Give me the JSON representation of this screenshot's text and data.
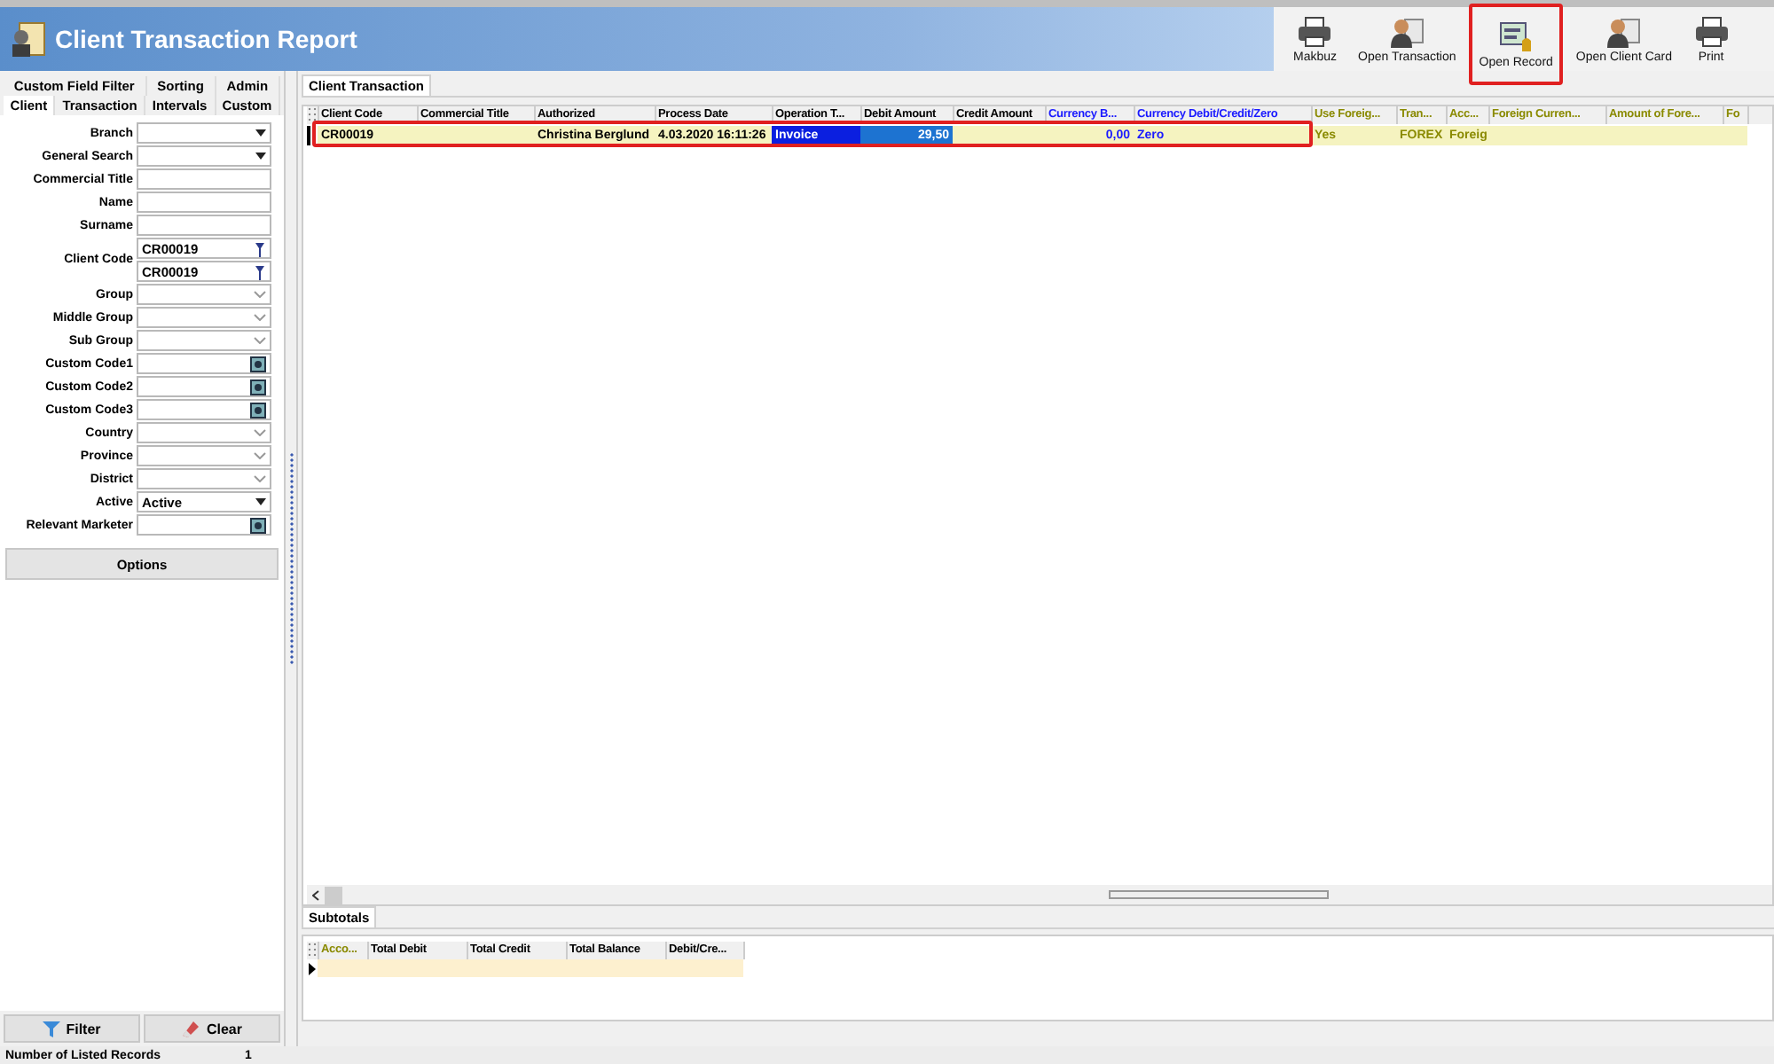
{
  "window": {
    "title": "Client Transaction Report"
  },
  "toolbar": [
    {
      "label": "Makbuz",
      "kind": "printer",
      "outlined": false
    },
    {
      "label": "Open Transaction",
      "kind": "person",
      "outlined": false
    },
    {
      "label": "Open Record",
      "kind": "record",
      "outlined": true
    },
    {
      "label": "Open Client Card",
      "kind": "person",
      "outlined": false
    },
    {
      "label": "Print",
      "kind": "printer",
      "outlined": false
    }
  ],
  "filter_tabs": [
    [
      {
        "label": "Custom Field Filter",
        "selected": false
      },
      {
        "label": "Sorting",
        "selected": false
      },
      {
        "label": "Admin",
        "selected": false
      }
    ],
    [
      {
        "label": "Client",
        "selected": true
      },
      {
        "label": "Transaction",
        "selected": false
      },
      {
        "label": "Intervals",
        "selected": false
      },
      {
        "label": "Custom",
        "selected": false
      }
    ]
  ],
  "fields": [
    {
      "label": "Branch",
      "kind": "dropdown"
    },
    {
      "label": "General Search",
      "kind": "dropdown"
    },
    {
      "label": "Commercial Title",
      "kind": "text"
    },
    {
      "label": "Name",
      "kind": "text"
    },
    {
      "label": "Surname",
      "kind": "text"
    },
    {
      "label": "Client Code",
      "kind": "code",
      "values": [
        "CR00019",
        "CR00019"
      ]
    },
    {
      "label": "Group",
      "kind": "combo"
    },
    {
      "label": "Middle Group",
      "kind": "combo"
    },
    {
      "label": "Sub Group",
      "kind": "combo"
    },
    {
      "label": "Custom Code1",
      "kind": "lookup"
    },
    {
      "label": "Custom Code2",
      "kind": "lookup"
    },
    {
      "label": "Custom Code3",
      "kind": "lookup"
    },
    {
      "label": "Country",
      "kind": "combo"
    },
    {
      "label": "Province",
      "kind": "combo"
    },
    {
      "label": "District",
      "kind": "combo"
    },
    {
      "label": "Active",
      "kind": "dropdown",
      "values": [
        "Active"
      ]
    },
    {
      "label": "Relevant Marketer",
      "kind": "lookup"
    }
  ],
  "options_button": "Options",
  "filter_button": "Filter",
  "clear_button": "Clear",
  "main_tab": "Client Transaction",
  "table": {
    "columns": [
      {
        "label": "Client Code",
        "color": "#000000"
      },
      {
        "label": "Commercial Title",
        "color": "#000000"
      },
      {
        "label": "Authorized",
        "color": "#000000"
      },
      {
        "label": "Process Date",
        "color": "#000000"
      },
      {
        "label": "Operation T...",
        "color": "#000000"
      },
      {
        "label": "Debit Amount",
        "color": "#000000"
      },
      {
        "label": "Credit Amount",
        "color": "#000000"
      },
      {
        "label": "Currency B...",
        "color": "#1a1aff"
      },
      {
        "label": "Currency Debit/Credit/Zero",
        "color": "#1a1aff"
      },
      {
        "label": "Use Foreig...",
        "color": "#8a8a00"
      },
      {
        "label": "Tran...",
        "color": "#8a8a00"
      },
      {
        "label": "Acc...",
        "color": "#8a8a00"
      },
      {
        "label": "Foreign Curren...",
        "color": "#8a8a00"
      },
      {
        "label": "Amount of Fore...",
        "color": "#8a8a00"
      },
      {
        "label": "Fo",
        "color": "#8a8a00"
      }
    ],
    "rows": [
      {
        "outlined": true,
        "cells": [
          {
            "text": "CR00019",
            "selected": false
          },
          {
            "selected": false
          },
          {
            "text": "Christina Berglund",
            "selected": false
          },
          {
            "text": "4.03.2020 16:11:26",
            "selected": false
          },
          {
            "text": "Invoice",
            "selected": true
          },
          {
            "text": "29,50",
            "selected": true
          },
          {
            "selected": false
          },
          {
            "text": "0,00",
            "selected": false
          },
          {
            "text": "Zero",
            "selected": false
          },
          {
            "text": "Yes",
            "selected": false
          },
          {
            "text": "FOREX",
            "selected": false
          },
          {
            "text": "Foreig",
            "selected": false
          },
          {
            "selected": false
          },
          {
            "selected": false
          },
          {
            "selected": false
          }
        ]
      }
    ]
  },
  "subtotals": {
    "tab": "Subtotals",
    "columns": [
      {
        "label": "Acco...",
        "color": "#8a8a00"
      },
      {
        "label": "Total Debit",
        "color": "#000000"
      },
      {
        "label": "Total Credit",
        "color": "#000000"
      },
      {
        "label": "Total Balance",
        "color": "#000000"
      },
      {
        "label": "Debit/Cre...",
        "color": "#000000"
      }
    ]
  },
  "status_bar": {
    "label": "Number of Listed Records",
    "value": "1"
  }
}
